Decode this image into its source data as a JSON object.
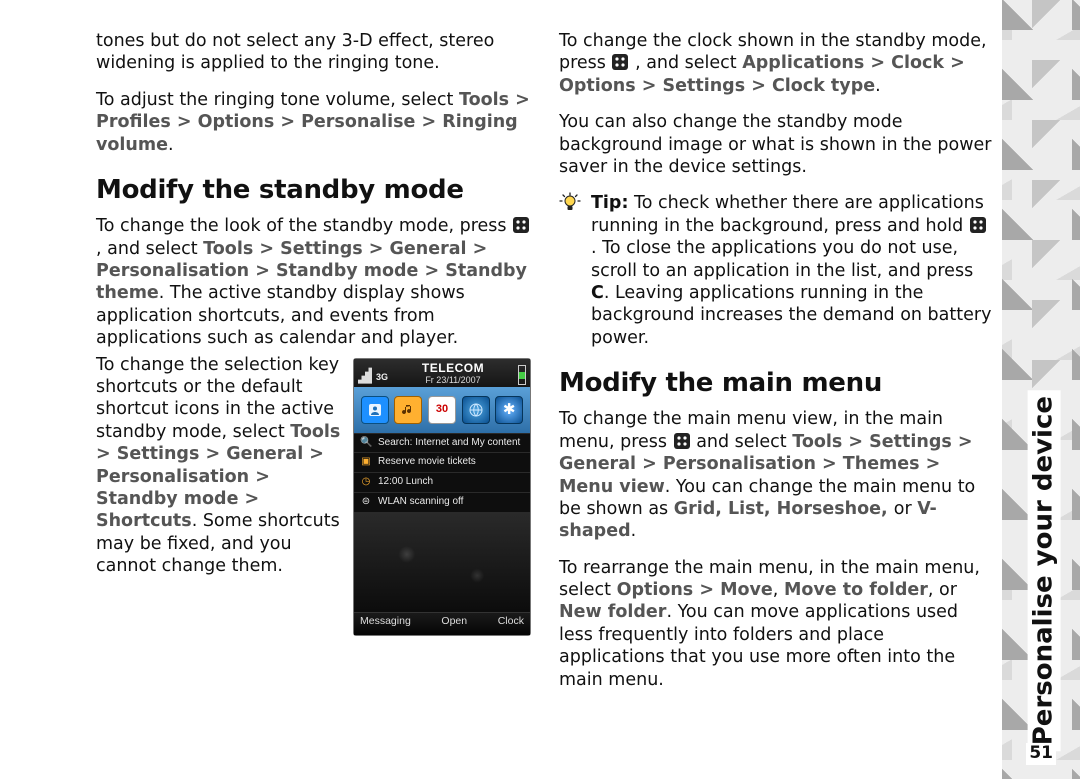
{
  "section_title": "Personalise your device",
  "page_number": "51",
  "col1": {
    "p1_a": "tones but do not select any 3-D effect, stereo widening is applied to the ringing tone.",
    "p2_a": "To adjust the ringing tone volume, select ",
    "p2_path": "Tools > Profiles > Options > Personalise > Ringing volume",
    "p2_b": ".",
    "h_standby": "Modify the standby mode",
    "p3_a": "To change the look of the standby mode, press ",
    "p3_b": " , and select ",
    "p3_path": "Tools > Settings > General > Personalisation > Standby mode > Standby theme",
    "p3_c": ".  The active standby display shows application shortcuts, and events from applications such as calendar and player.",
    "p4_a": "To change the selection key shortcuts or the default shortcut icons in the active standby mode, select ",
    "p4_path": "Tools > Settings > General > Personalisation > Standby mode > Shortcuts",
    "p4_b": ". Some shortcuts may be fixed, and you cannot change them."
  },
  "phone": {
    "operator": "TELECOM",
    "date": "Fr 23/11/2007",
    "cal_day": "30",
    "row_search": "Search: Internet and My content",
    "row_movie": "Reserve movie tickets",
    "row_lunch": "12:00 Lunch",
    "row_wlan": "WLAN scanning off",
    "sk_left": "Messaging",
    "sk_mid": "Open",
    "sk_right": "Clock"
  },
  "col2": {
    "p1_a": "To change the clock shown in the standby mode, press ",
    "p1_b": " , and select ",
    "p1_path": "Applications > Clock > Options > Settings > Clock type",
    "p1_c": ".",
    "p2": "You can also change the standby mode background image or what is shown in the power saver in the device settings.",
    "tip_label": "Tip:",
    "tip_a": "  To check whether there are applications running in the background, press and hold ",
    "tip_b": " . To close the applications you do not use, scroll to an application in the list, and press ",
    "tip_key": "C",
    "tip_c": ". Leaving applications running in the background increases the demand on battery power.",
    "h_menu": "Modify the main menu",
    "p3_a": "To change the main menu view, in the main menu, press ",
    "p3_b": " and select ",
    "p3_path": "Tools > Settings > General > Personalisation > Themes > Menu view",
    "p3_c": ". You can change the main menu to be shown as ",
    "p3_opts": "Grid, List, Horseshoe, ",
    "p3_or": "or ",
    "p3_last": "V-shaped",
    "p3_d": ".",
    "p4_a": "To rearrange the main menu, in the main menu, select ",
    "p4_path1": "Options > Move",
    "p4_comma": ", ",
    "p4_path2": "Move to folder",
    "p4_or": ", or ",
    "p4_path3": "New folder",
    "p4_b": ". You can move applications used less frequently into folders and place applications that you use more often into the main menu."
  }
}
